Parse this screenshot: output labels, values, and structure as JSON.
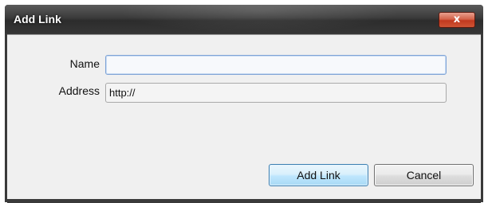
{
  "dialog": {
    "title": "Add Link",
    "close_symbol": "x"
  },
  "form": {
    "name_label": "Name",
    "name_value": "",
    "address_label": "Address",
    "address_value": "http://"
  },
  "buttons": {
    "add_link": "Add Link",
    "cancel": "Cancel"
  },
  "colors": {
    "titlebar": "#3b3b3b",
    "close_button": "#c0391f",
    "client_background": "#f0f0f0",
    "primary_button": "#bee6fd"
  }
}
